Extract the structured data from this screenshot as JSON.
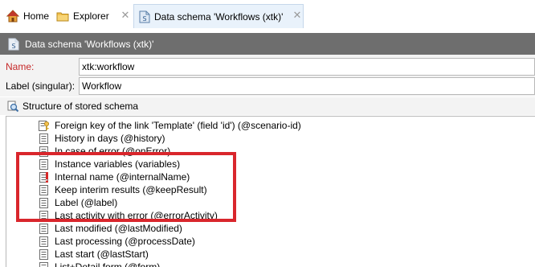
{
  "tabs": [
    {
      "label": "Home",
      "icon": "home-icon"
    },
    {
      "label": "Explorer",
      "icon": "folder-icon"
    },
    {
      "label": "Data schema 'Workflows (xtk)'",
      "icon": "schema-icon",
      "active": true
    }
  ],
  "titlebar": {
    "title": "Data schema 'Workflows (xtk)'"
  },
  "form": {
    "name_label": "Name:",
    "name_value": "xtk:workflow",
    "label_label": "Label (singular):",
    "label_value": "Workflow"
  },
  "section": {
    "title": "Structure of stored schema"
  },
  "tree": {
    "items": [
      {
        "label": "Foreign key of the link 'Template' (field 'id') (@scenario-id)",
        "icon": "foreign-key-icon"
      },
      {
        "label": "History in days (@history)",
        "icon": "attribute-icon"
      },
      {
        "label": "In case of error (@onError)",
        "icon": "attribute-icon"
      },
      {
        "label": "Instance variables (variables)",
        "icon": "attribute-icon"
      },
      {
        "label": "Internal name (@internalName)",
        "icon": "required-attribute-icon"
      },
      {
        "label": "Keep interim results (@keepResult)",
        "icon": "attribute-icon"
      },
      {
        "label": "Label (@label)",
        "icon": "attribute-icon"
      },
      {
        "label": "Last activity with error (@errorActivity)",
        "icon": "attribute-icon"
      },
      {
        "label": "Last modified (@lastModified)",
        "icon": "attribute-icon"
      },
      {
        "label": "Last processing (@processDate)",
        "icon": "attribute-icon"
      },
      {
        "label": "Last start (@lastStart)",
        "icon": "attribute-icon"
      },
      {
        "label": "List+Detail form (@form)",
        "icon": "attribute-icon"
      }
    ]
  },
  "colors": {
    "highlight": "#d9262c",
    "titlebar": "#6e6e6e",
    "required_label": "#c62828",
    "active_tab": "#e9f2fb"
  }
}
